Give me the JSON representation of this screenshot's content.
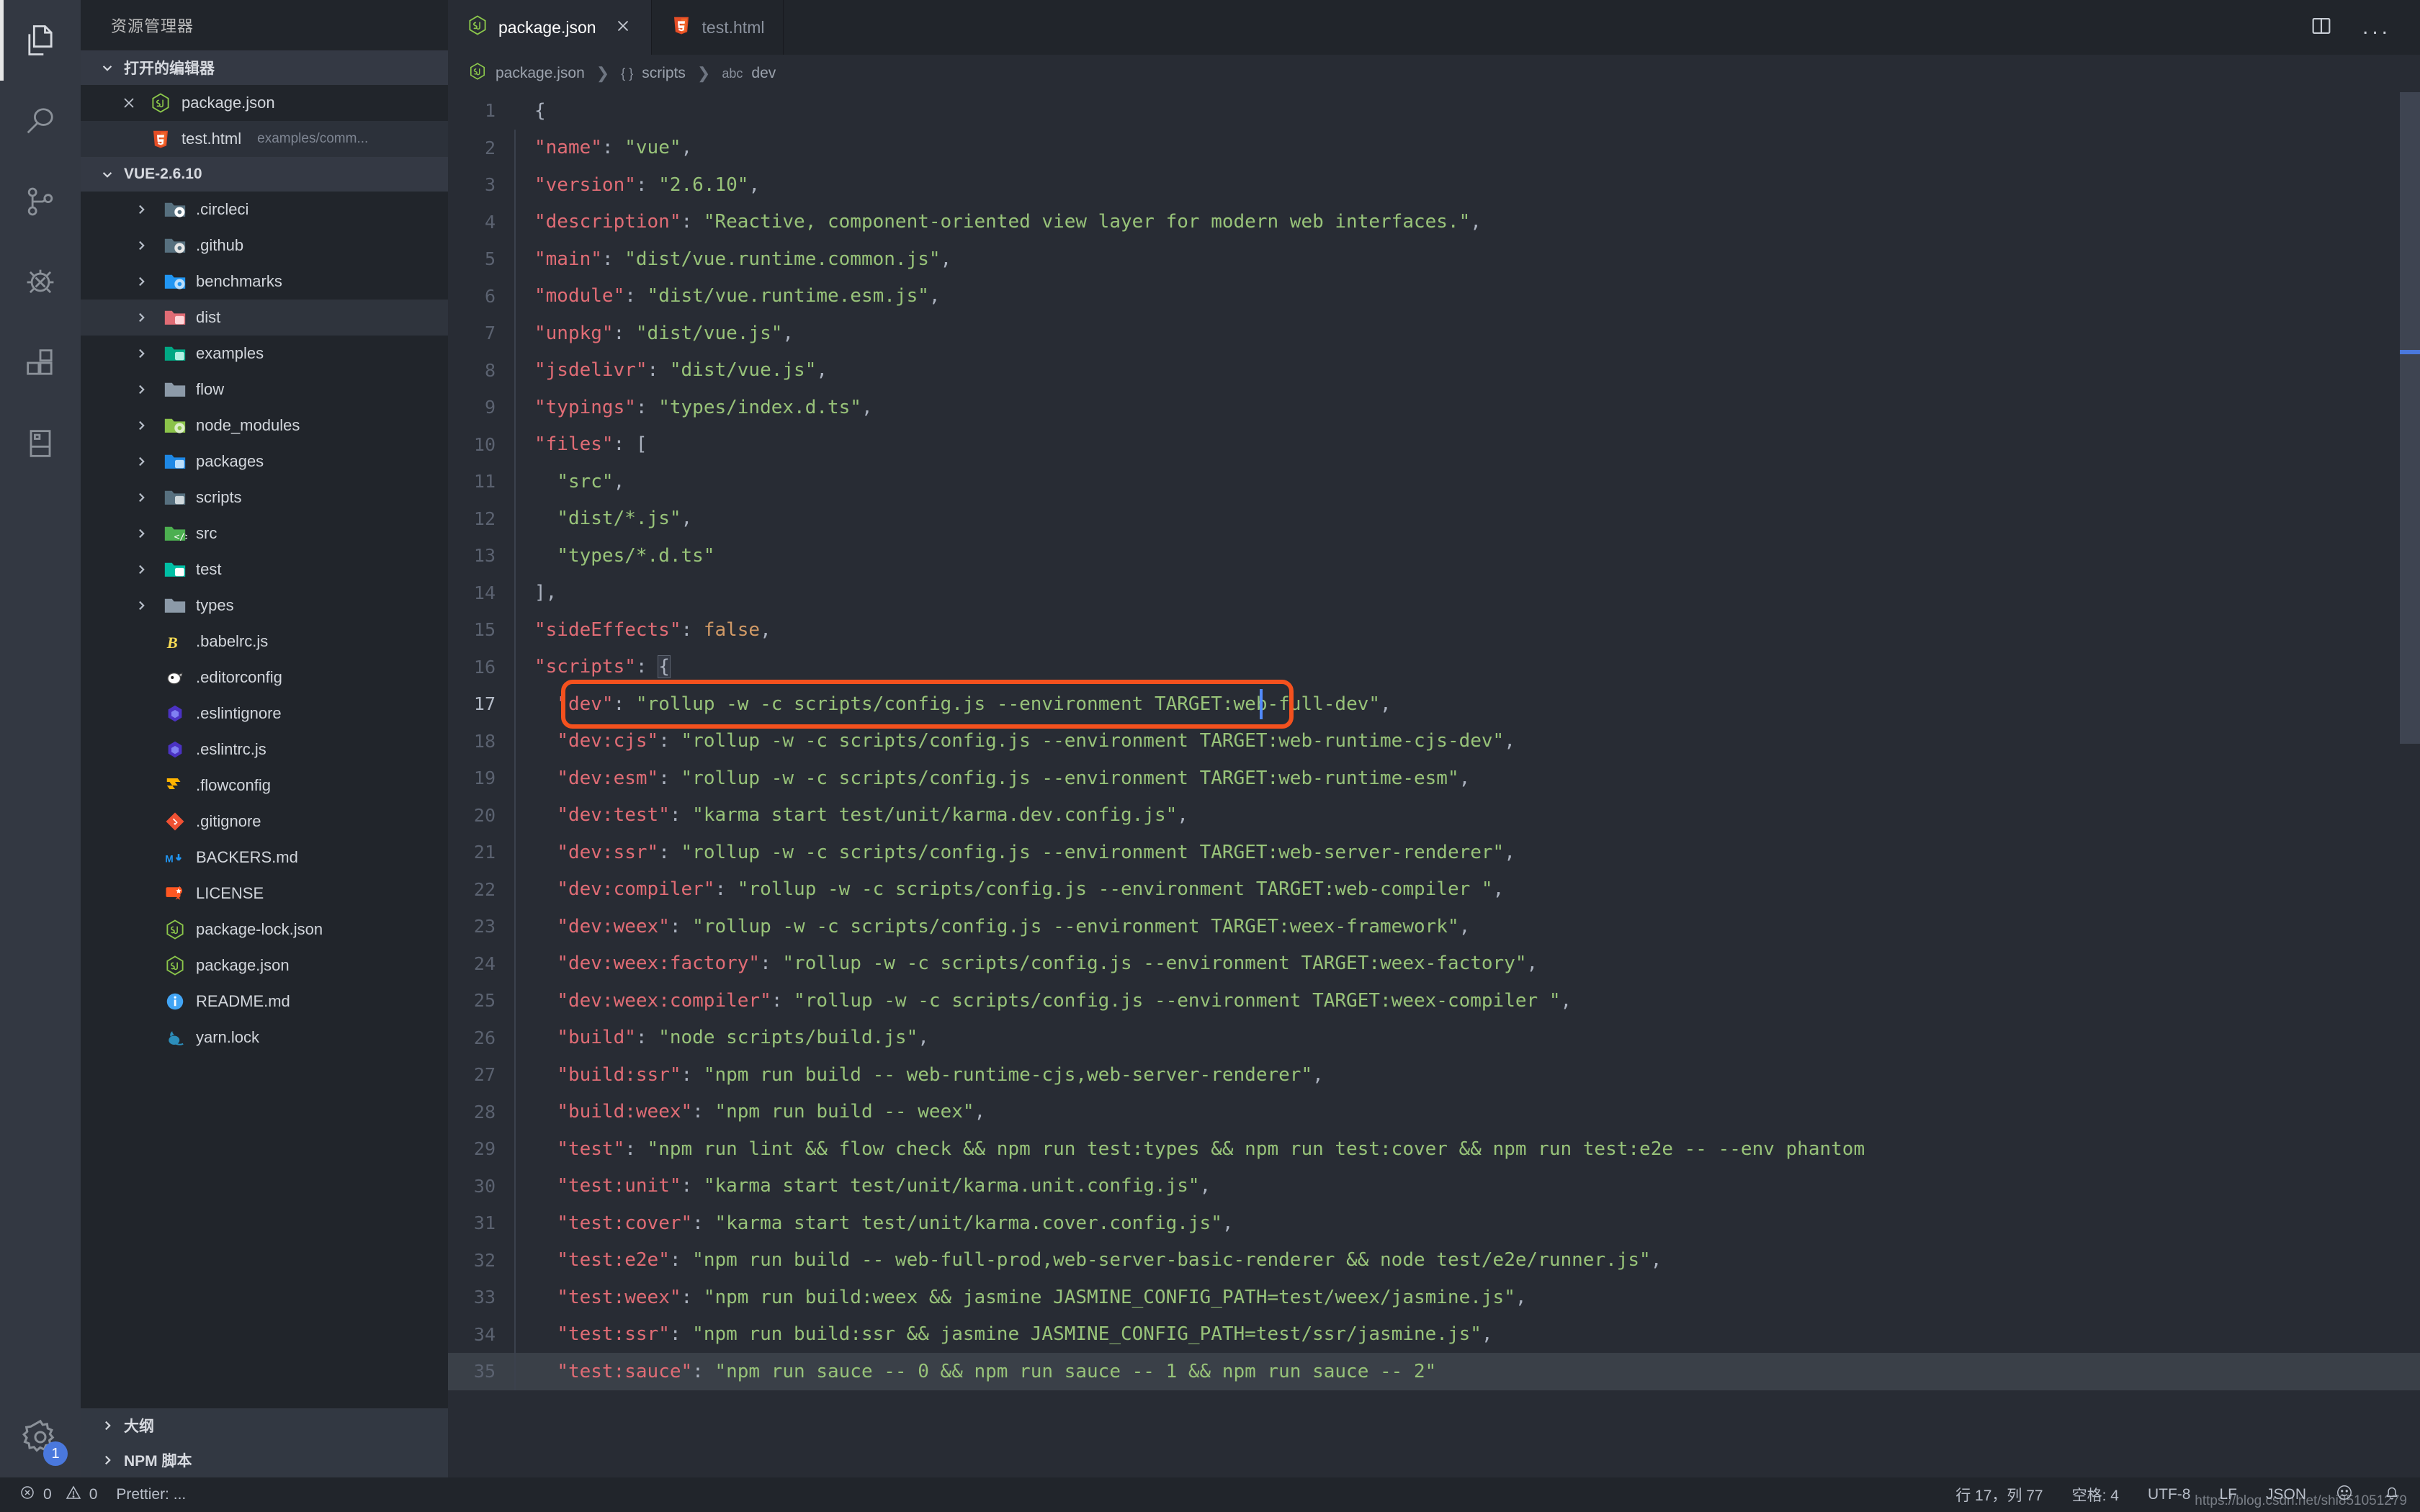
{
  "activity_bar": {
    "items": [
      {
        "name": "explorer",
        "icon": "files-icon",
        "active": true
      },
      {
        "name": "search",
        "icon": "search-icon",
        "active": false
      },
      {
        "name": "source-control",
        "icon": "source-control-icon",
        "active": false
      },
      {
        "name": "run-debug",
        "icon": "debug-icon",
        "active": false
      },
      {
        "name": "extensions",
        "icon": "extensions-icon",
        "active": false
      },
      {
        "name": "remote-explorer",
        "icon": "remote-icon",
        "active": false
      }
    ],
    "settings_icon": "gear-icon",
    "settings_badge": "1"
  },
  "sidebar": {
    "title": "资源管理器",
    "open_editors": {
      "label": "打开的编辑器",
      "items": [
        {
          "name": "package.json",
          "path": "",
          "icon": "js-icon",
          "has_close": true,
          "selected": false
        },
        {
          "name": "test.html",
          "path": "examples/comm...",
          "icon": "html-icon",
          "has_close": false,
          "selected": true
        }
      ]
    },
    "workspace": {
      "label": "VUE-2.6.10",
      "items": [
        {
          "name": ".circleci",
          "type": "folder",
          "icon": "folder-circleci-icon",
          "selected": false
        },
        {
          "name": ".github",
          "type": "folder",
          "icon": "folder-github-icon",
          "selected": false
        },
        {
          "name": "benchmarks",
          "type": "folder",
          "icon": "folder-benchmark-icon",
          "selected": false
        },
        {
          "name": "dist",
          "type": "folder",
          "icon": "folder-dist-icon",
          "selected": true
        },
        {
          "name": "examples",
          "type": "folder",
          "icon": "folder-examples-icon",
          "selected": false
        },
        {
          "name": "flow",
          "type": "folder",
          "icon": "folder-plain-icon",
          "selected": false
        },
        {
          "name": "node_modules",
          "type": "folder",
          "icon": "folder-node-icon",
          "selected": false
        },
        {
          "name": "packages",
          "type": "folder",
          "icon": "folder-packages-icon",
          "selected": false
        },
        {
          "name": "scripts",
          "type": "folder",
          "icon": "folder-scripts-icon",
          "selected": false
        },
        {
          "name": "src",
          "type": "folder",
          "icon": "folder-src-icon",
          "selected": false
        },
        {
          "name": "test",
          "type": "folder",
          "icon": "folder-test-icon",
          "selected": false
        },
        {
          "name": "types",
          "type": "folder",
          "icon": "folder-plain-icon",
          "selected": false
        },
        {
          "name": ".babelrc.js",
          "type": "file",
          "icon": "babel-icon",
          "selected": false
        },
        {
          "name": ".editorconfig",
          "type": "file",
          "icon": "editorconfig-icon",
          "selected": false
        },
        {
          "name": ".eslintignore",
          "type": "file",
          "icon": "eslint-icon",
          "selected": false
        },
        {
          "name": ".eslintrc.js",
          "type": "file",
          "icon": "eslint-icon",
          "selected": false
        },
        {
          "name": ".flowconfig",
          "type": "file",
          "icon": "flow-icon",
          "selected": false
        },
        {
          "name": ".gitignore",
          "type": "file",
          "icon": "git-icon",
          "selected": false
        },
        {
          "name": "BACKERS.md",
          "type": "file",
          "icon": "markdown-icon",
          "selected": false
        },
        {
          "name": "LICENSE",
          "type": "file",
          "icon": "license-icon",
          "selected": false
        },
        {
          "name": "package-lock.json",
          "type": "file",
          "icon": "js-icon",
          "selected": false
        },
        {
          "name": "package.json",
          "type": "file",
          "icon": "js-icon",
          "selected": false
        },
        {
          "name": "README.md",
          "type": "file",
          "icon": "readme-icon",
          "selected": false
        },
        {
          "name": "yarn.lock",
          "type": "file",
          "icon": "yarn-icon",
          "selected": false
        }
      ]
    },
    "bottom_sections": [
      {
        "label": "大纲"
      },
      {
        "label": "NPM 脚本"
      }
    ]
  },
  "tabs": [
    {
      "label": "package.json",
      "icon": "js-icon",
      "active": true,
      "closable": true
    },
    {
      "label": "test.html",
      "icon": "html-icon",
      "active": false,
      "closable": false
    }
  ],
  "tab_actions": {
    "split_editor": "split-editor-icon",
    "more_actions": "..."
  },
  "breadcrumb": {
    "icon": "js-icon",
    "parts": [
      {
        "label": "package.json",
        "kind": ""
      },
      {
        "label": "scripts",
        "kind": "{ }"
      },
      {
        "label": "dev",
        "kind": "abc"
      }
    ]
  },
  "editor": {
    "language": "JSON",
    "cursor": {
      "line": 17,
      "column": 77
    },
    "lines": [
      {
        "n": 1,
        "indent": 0,
        "tokens": [
          {
            "t": "{",
            "c": "p"
          }
        ]
      },
      {
        "n": 2,
        "indent": 1,
        "tokens": [
          {
            "t": "\"name\"",
            "c": "k"
          },
          {
            "t": ": ",
            "c": "p"
          },
          {
            "t": "\"vue\"",
            "c": "s"
          },
          {
            "t": ",",
            "c": "p"
          }
        ]
      },
      {
        "n": 3,
        "indent": 1,
        "tokens": [
          {
            "t": "\"version\"",
            "c": "k"
          },
          {
            "t": ": ",
            "c": "p"
          },
          {
            "t": "\"2.6.10\"",
            "c": "s"
          },
          {
            "t": ",",
            "c": "p"
          }
        ]
      },
      {
        "n": 4,
        "indent": 1,
        "tokens": [
          {
            "t": "\"description\"",
            "c": "k"
          },
          {
            "t": ": ",
            "c": "p"
          },
          {
            "t": "\"Reactive, component-oriented view layer for modern web interfaces.\"",
            "c": "s"
          },
          {
            "t": ",",
            "c": "p"
          }
        ]
      },
      {
        "n": 5,
        "indent": 1,
        "tokens": [
          {
            "t": "\"main\"",
            "c": "k"
          },
          {
            "t": ": ",
            "c": "p"
          },
          {
            "t": "\"dist/vue.runtime.common.js\"",
            "c": "s"
          },
          {
            "t": ",",
            "c": "p"
          }
        ]
      },
      {
        "n": 6,
        "indent": 1,
        "tokens": [
          {
            "t": "\"module\"",
            "c": "k"
          },
          {
            "t": ": ",
            "c": "p"
          },
          {
            "t": "\"dist/vue.runtime.esm.js\"",
            "c": "s"
          },
          {
            "t": ",",
            "c": "p"
          }
        ]
      },
      {
        "n": 7,
        "indent": 1,
        "tokens": [
          {
            "t": "\"unpkg\"",
            "c": "k"
          },
          {
            "t": ": ",
            "c": "p"
          },
          {
            "t": "\"dist/vue.js\"",
            "c": "s"
          },
          {
            "t": ",",
            "c": "p"
          }
        ]
      },
      {
        "n": 8,
        "indent": 1,
        "tokens": [
          {
            "t": "\"jsdelivr\"",
            "c": "k"
          },
          {
            "t": ": ",
            "c": "p"
          },
          {
            "t": "\"dist/vue.js\"",
            "c": "s"
          },
          {
            "t": ",",
            "c": "p"
          }
        ]
      },
      {
        "n": 9,
        "indent": 1,
        "tokens": [
          {
            "t": "\"typings\"",
            "c": "k"
          },
          {
            "t": ": ",
            "c": "p"
          },
          {
            "t": "\"types/index.d.ts\"",
            "c": "s"
          },
          {
            "t": ",",
            "c": "p"
          }
        ]
      },
      {
        "n": 10,
        "indent": 1,
        "tokens": [
          {
            "t": "\"files\"",
            "c": "k"
          },
          {
            "t": ": [",
            "c": "p"
          }
        ]
      },
      {
        "n": 11,
        "indent": 2,
        "tokens": [
          {
            "t": "\"src\"",
            "c": "s"
          },
          {
            "t": ",",
            "c": "p"
          }
        ]
      },
      {
        "n": 12,
        "indent": 2,
        "tokens": [
          {
            "t": "\"dist/*.js\"",
            "c": "s"
          },
          {
            "t": ",",
            "c": "p"
          }
        ]
      },
      {
        "n": 13,
        "indent": 2,
        "tokens": [
          {
            "t": "\"types/*.d.ts\"",
            "c": "s"
          }
        ]
      },
      {
        "n": 14,
        "indent": 1,
        "tokens": [
          {
            "t": "],",
            "c": "p"
          }
        ]
      },
      {
        "n": 15,
        "indent": 1,
        "tokens": [
          {
            "t": "\"sideEffects\"",
            "c": "k"
          },
          {
            "t": ": ",
            "c": "p"
          },
          {
            "t": "false",
            "c": "b"
          },
          {
            "t": ",",
            "c": "p"
          }
        ]
      },
      {
        "n": 16,
        "indent": 1,
        "tokens": [
          {
            "t": "\"scripts\"",
            "c": "k"
          },
          {
            "t": ": ",
            "c": "p"
          },
          {
            "t": "{",
            "c": "brace"
          }
        ]
      },
      {
        "n": 17,
        "indent": 2,
        "tokens": [
          {
            "t": "\"dev\"",
            "c": "k"
          },
          {
            "t": ": ",
            "c": "p"
          },
          {
            "t": "\"rollup -w -c scripts/config.js --environment TARGET:web-full-dev\"",
            "c": "s"
          },
          {
            "t": ",",
            "c": "p"
          }
        ],
        "annotated": true
      },
      {
        "n": 18,
        "indent": 2,
        "tokens": [
          {
            "t": "\"dev:cjs\"",
            "c": "k"
          },
          {
            "t": ": ",
            "c": "p"
          },
          {
            "t": "\"rollup -w -c scripts/config.js --environment TARGET:web-runtime-cjs-dev\"",
            "c": "s"
          },
          {
            "t": ",",
            "c": "p"
          }
        ]
      },
      {
        "n": 19,
        "indent": 2,
        "tokens": [
          {
            "t": "\"dev:esm\"",
            "c": "k"
          },
          {
            "t": ": ",
            "c": "p"
          },
          {
            "t": "\"rollup -w -c scripts/config.js --environment TARGET:web-runtime-esm\"",
            "c": "s"
          },
          {
            "t": ",",
            "c": "p"
          }
        ]
      },
      {
        "n": 20,
        "indent": 2,
        "tokens": [
          {
            "t": "\"dev:test\"",
            "c": "k"
          },
          {
            "t": ": ",
            "c": "p"
          },
          {
            "t": "\"karma start test/unit/karma.dev.config.js\"",
            "c": "s"
          },
          {
            "t": ",",
            "c": "p"
          }
        ]
      },
      {
        "n": 21,
        "indent": 2,
        "tokens": [
          {
            "t": "\"dev:ssr\"",
            "c": "k"
          },
          {
            "t": ": ",
            "c": "p"
          },
          {
            "t": "\"rollup -w -c scripts/config.js --environment TARGET:web-server-renderer\"",
            "c": "s"
          },
          {
            "t": ",",
            "c": "p"
          }
        ]
      },
      {
        "n": 22,
        "indent": 2,
        "tokens": [
          {
            "t": "\"dev:compiler\"",
            "c": "k"
          },
          {
            "t": ": ",
            "c": "p"
          },
          {
            "t": "\"rollup -w -c scripts/config.js --environment TARGET:web-compiler \"",
            "c": "s"
          },
          {
            "t": ",",
            "c": "p"
          }
        ]
      },
      {
        "n": 23,
        "indent": 2,
        "tokens": [
          {
            "t": "\"dev:weex\"",
            "c": "k"
          },
          {
            "t": ": ",
            "c": "p"
          },
          {
            "t": "\"rollup -w -c scripts/config.js --environment TARGET:weex-framework\"",
            "c": "s"
          },
          {
            "t": ",",
            "c": "p"
          }
        ]
      },
      {
        "n": 24,
        "indent": 2,
        "tokens": [
          {
            "t": "\"dev:weex:factory\"",
            "c": "k"
          },
          {
            "t": ": ",
            "c": "p"
          },
          {
            "t": "\"rollup -w -c scripts/config.js --environment TARGET:weex-factory\"",
            "c": "s"
          },
          {
            "t": ",",
            "c": "p"
          }
        ]
      },
      {
        "n": 25,
        "indent": 2,
        "tokens": [
          {
            "t": "\"dev:weex:compiler\"",
            "c": "k"
          },
          {
            "t": ": ",
            "c": "p"
          },
          {
            "t": "\"rollup -w -c scripts/config.js --environment TARGET:weex-compiler \"",
            "c": "s"
          },
          {
            "t": ",",
            "c": "p"
          }
        ]
      },
      {
        "n": 26,
        "indent": 2,
        "tokens": [
          {
            "t": "\"build\"",
            "c": "k"
          },
          {
            "t": ": ",
            "c": "p"
          },
          {
            "t": "\"node scripts/build.js\"",
            "c": "s"
          },
          {
            "t": ",",
            "c": "p"
          }
        ]
      },
      {
        "n": 27,
        "indent": 2,
        "tokens": [
          {
            "t": "\"build:ssr\"",
            "c": "k"
          },
          {
            "t": ": ",
            "c": "p"
          },
          {
            "t": "\"npm run build -- web-runtime-cjs,web-server-renderer\"",
            "c": "s"
          },
          {
            "t": ",",
            "c": "p"
          }
        ]
      },
      {
        "n": 28,
        "indent": 2,
        "tokens": [
          {
            "t": "\"build:weex\"",
            "c": "k"
          },
          {
            "t": ": ",
            "c": "p"
          },
          {
            "t": "\"npm run build -- weex\"",
            "c": "s"
          },
          {
            "t": ",",
            "c": "p"
          }
        ]
      },
      {
        "n": 29,
        "indent": 2,
        "tokens": [
          {
            "t": "\"test\"",
            "c": "k"
          },
          {
            "t": ": ",
            "c": "p"
          },
          {
            "t": "\"npm run lint && flow check && npm run test:types && npm run test:cover && npm run test:e2e -- --env phantom",
            "c": "s"
          }
        ]
      },
      {
        "n": 30,
        "indent": 2,
        "tokens": [
          {
            "t": "\"test:unit\"",
            "c": "k"
          },
          {
            "t": ": ",
            "c": "p"
          },
          {
            "t": "\"karma start test/unit/karma.unit.config.js\"",
            "c": "s"
          },
          {
            "t": ",",
            "c": "p"
          }
        ]
      },
      {
        "n": 31,
        "indent": 2,
        "tokens": [
          {
            "t": "\"test:cover\"",
            "c": "k"
          },
          {
            "t": ": ",
            "c": "p"
          },
          {
            "t": "\"karma start test/unit/karma.cover.config.js\"",
            "c": "s"
          },
          {
            "t": ",",
            "c": "p"
          }
        ]
      },
      {
        "n": 32,
        "indent": 2,
        "tokens": [
          {
            "t": "\"test:e2e\"",
            "c": "k"
          },
          {
            "t": ": ",
            "c": "p"
          },
          {
            "t": "\"npm run build -- web-full-prod,web-server-basic-renderer && node test/e2e/runner.js\"",
            "c": "s"
          },
          {
            "t": ",",
            "c": "p"
          }
        ]
      },
      {
        "n": 33,
        "indent": 2,
        "tokens": [
          {
            "t": "\"test:weex\"",
            "c": "k"
          },
          {
            "t": ": ",
            "c": "p"
          },
          {
            "t": "\"npm run build:weex && jasmine JASMINE_CONFIG_PATH=test/weex/jasmine.js\"",
            "c": "s"
          },
          {
            "t": ",",
            "c": "p"
          }
        ]
      },
      {
        "n": 34,
        "indent": 2,
        "tokens": [
          {
            "t": "\"test:ssr\"",
            "c": "k"
          },
          {
            "t": ": ",
            "c": "p"
          },
          {
            "t": "\"npm run build:ssr && jasmine JASMINE_CONFIG_PATH=test/ssr/jasmine.js\"",
            "c": "s"
          },
          {
            "t": ",",
            "c": "p"
          }
        ]
      },
      {
        "n": 35,
        "indent": 2,
        "tokens": [
          {
            "t": "\"test:sauce\"",
            "c": "k"
          },
          {
            "t": ": ",
            "c": "p"
          },
          {
            "t": "\"npm run sauce -- 0 && npm run sauce -- 1 && npm run sauce -- 2\"",
            "c": "s"
          }
        ],
        "lastHighlight": true
      }
    ]
  },
  "status_bar": {
    "errors_icon": "error-circle-icon",
    "errors": "0",
    "warnings_icon": "warning-triangle-icon",
    "warnings": "0",
    "prettier": "Prettier: ...",
    "position": "行 17，列 77",
    "indentation": "空格: 4",
    "encoding": "UTF-8",
    "eol": "LF",
    "language": "JSON",
    "feedback_icon": "smiley-icon",
    "bell_icon": "bell-icon",
    "watermark": "https://blog.csdn.net/shi851051279"
  },
  "colors": {
    "editor_bg": "#282c34",
    "sidebar_bg": "#21252b",
    "activity_bg": "#333842",
    "accent": "#528bff",
    "annotation": "#f4511e",
    "key": "#e06c75",
    "string": "#98c379",
    "punctuation": "#abb2bf",
    "boolean": "#d19a66"
  }
}
